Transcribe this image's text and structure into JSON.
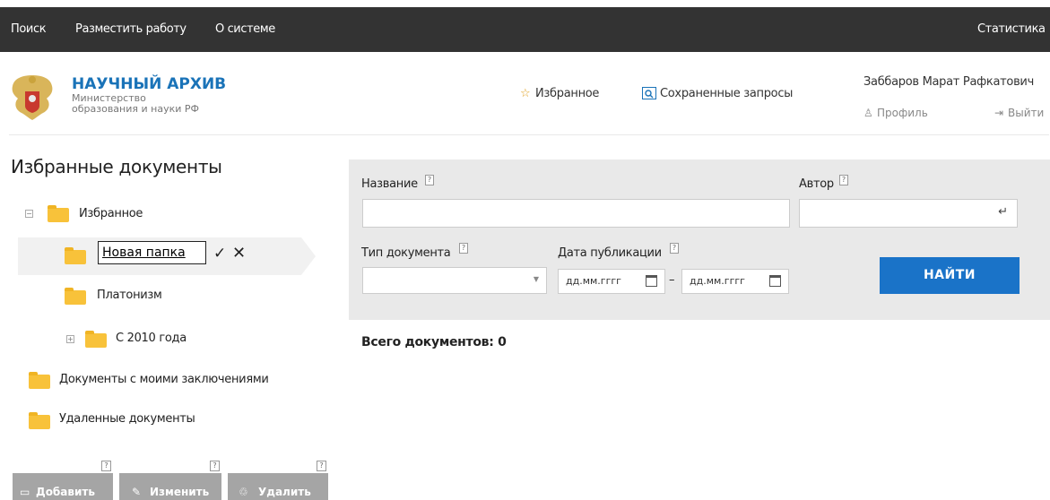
{
  "topnav": {
    "search": "Поиск",
    "submit": "Разместить работу",
    "about": "О системе",
    "stats": "Статистика"
  },
  "brand": {
    "title": "НАУЧНЫЙ АРХИВ",
    "sub1": "Министерство",
    "sub2": "образования и науки РФ"
  },
  "header": {
    "favorites": "Избранное",
    "saved_queries": "Сохраненные запросы",
    "user_name": "Заббаров Марат Рафкатович",
    "profile": "Профиль",
    "logout": "Выйти"
  },
  "page_title": "Избранные документы",
  "tree": {
    "root": "Избранное",
    "editing_value": "Новая папка",
    "platonism": "Платонизм",
    "since2010": "С 2010 года",
    "my_conclusions": "Документы с моими заключениями",
    "deleted": "Удаленные документы"
  },
  "buttons": {
    "add": "Добавить",
    "edit": "Изменить",
    "delete": "Удалить",
    "help": "?"
  },
  "search": {
    "title_label": "Название",
    "author_label": "Автор",
    "doctype_label": "Тип документа",
    "pubdate_label": "Дата публикации",
    "date_placeholder": "дд.мм.гггг",
    "dash": "–",
    "find": "НАЙТИ",
    "help": "?"
  },
  "total": "Всего документов: 0",
  "colors": {
    "topbar": "#333333",
    "accent": "#1a73c8",
    "folder": "#f8c23a"
  }
}
